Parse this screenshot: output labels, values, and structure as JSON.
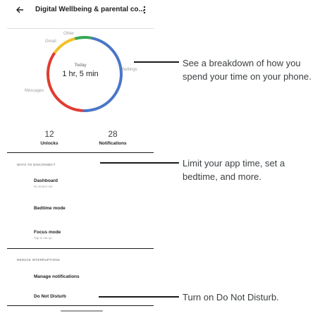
{
  "screen": {
    "title": "Digital Wellbeing & parental co...",
    "back_icon": "arrow-left-icon",
    "more_icon": "more-vert-icon"
  },
  "chart_data": {
    "type": "pie",
    "center_label": "Today",
    "center_value": "1 hr, 5 min",
    "categories": [
      "Settings",
      "Messages",
      "Gmail",
      "Other"
    ],
    "values": [
      48,
      34,
      11,
      7
    ],
    "colors": [
      "#4a76c9",
      "#e03c31",
      "#f2c027",
      "#34a853"
    ]
  },
  "stats": {
    "unlocks_value": "12",
    "unlocks_label": "Unlocks",
    "notifications_value": "28",
    "notifications_label": "Notifications"
  },
  "ways_section": {
    "heading": "WAYS TO DISCONNECT",
    "items": [
      {
        "title": "Dashboard",
        "subtitle": "No timers set"
      },
      {
        "title": "Bedtime mode",
        "subtitle": ""
      },
      {
        "title": "Focus mode",
        "subtitle": "Tap to set up"
      }
    ]
  },
  "reduce_section": {
    "heading": "REDUCE INTERRUPTIONS",
    "items": [
      {
        "title": "Manage notifications"
      },
      {
        "title": "Do Not Disturb"
      }
    ]
  },
  "callouts": {
    "breakdown": "See a breakdown of how you spend your time on your phone.",
    "limit": "Limit your app time, set a bedtime, and more.",
    "dnd": "Turn on Do Not Disturb."
  }
}
